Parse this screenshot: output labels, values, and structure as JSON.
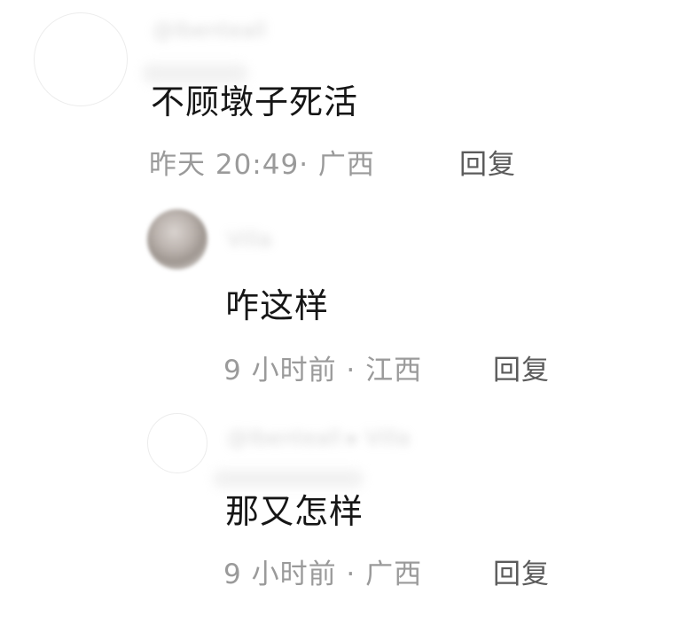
{
  "comments": [
    {
      "username": "@Ibenteall",
      "text": "不顾墩子死活",
      "meta": "昨天 20:49· 广西",
      "reply_label": "回复"
    },
    {
      "username": "Villa",
      "text": "咋这样",
      "meta": "9 小时前 · 江西",
      "reply_label": "回复"
    },
    {
      "username": "@Ibenteall ▸ Villa",
      "text": "那又怎样",
      "meta": "9 小时前 · 广西",
      "reply_label": "回复"
    }
  ]
}
